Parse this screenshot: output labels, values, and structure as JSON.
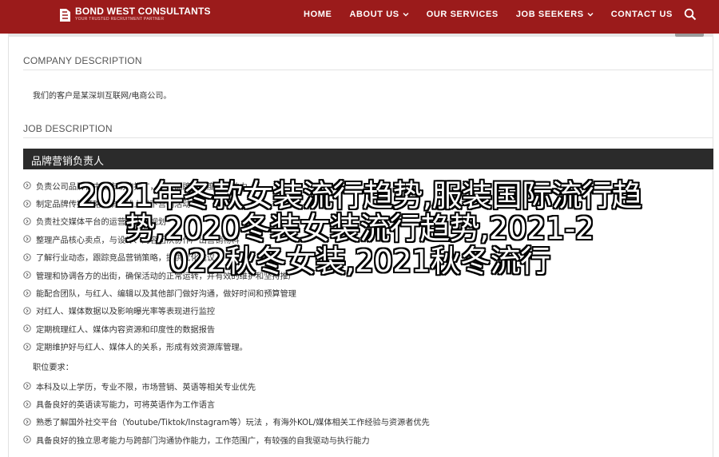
{
  "header": {
    "brand_name": "BOND WEST CONSULTANTS",
    "brand_tagline": "YOUR TRUSTED RECRUITMENT PARTNER",
    "nav": [
      {
        "label": "HOME",
        "has_menu": false
      },
      {
        "label": "ABOUT US",
        "has_menu": true
      },
      {
        "label": "OUR SERVICES",
        "has_menu": false
      },
      {
        "label": "JOB SEEKERS",
        "has_menu": true
      },
      {
        "label": "CONTACT US",
        "has_menu": false
      }
    ],
    "search_icon": "search-icon",
    "accent_color": "#9b1b1b"
  },
  "company": {
    "heading": "COMPANY DESCRIPTION",
    "text": "我们的客户是某深圳互联网/电商公司。"
  },
  "job": {
    "heading": "JOB DESCRIPTION",
    "title": "品牌营销负责人",
    "duties": [
      "负责公司品牌在中国市场的推广，扩大品牌知名度和影响力",
      "制定品牌传播策略，统筹线上线下营销活动",
      "负责社交媒体平台的运营与内容规划",
      "整理产品核心卖点，与设计、内容团队协作产出营销物料",
      "了解行业动态，跟踪竞品营销策略，提供优化建议",
      "管理和协调各方的出街，确保活动的正常运转，并有效的维护和坚持推广",
      "能配合团队，与红人、编辑以及其他部门做好沟通，做好时间和预算管理",
      "对红人、媒体数据以及影响曝光率等表现进行监控",
      "定期梳理红人、媒体内容资源和印度性的数据报告",
      "定期维护好与红人、媒体人的关系，形成有效资源库管理。"
    ],
    "requirements_heading": "职位要求：",
    "requirements": [
      "本科及以上学历，专业不限，市场营销、英语等相关专业优先",
      "具备良好的英语读写能力，可将英语作为工作语言",
      "熟悉了解国外社交平台（Youtube/Tiktok/Instagram等）玩法 ，有海外KOL/媒体相关工作经验与资源者优先",
      "具备良好的独立思考能力与跨部门沟通协作能力，工作范围广，有较强的自我驱动与执行能力"
    ]
  },
  "overlay": {
    "lines": [
      "2021年冬款女装流行趋势,服装国际流行趋",
      "势,2020冬装女装流行趋势,2021-2",
      "022秋冬女装,2021秋冬流行"
    ]
  },
  "icons": {
    "bullet": "arrow-circle-icon",
    "caret": "chevron-down-icon",
    "logo": "logo-mark-icon"
  }
}
